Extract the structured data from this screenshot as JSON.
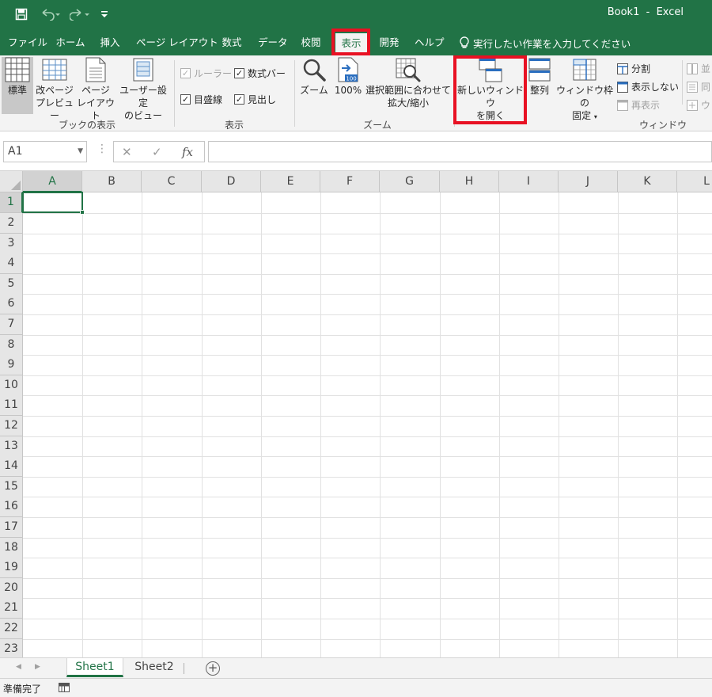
{
  "window": {
    "title": "Book1  -  Excel"
  },
  "quick_access": {
    "save": "save-icon",
    "undo": "undo-icon",
    "redo": "redo-icon",
    "customize": "customize-icon"
  },
  "tabs": [
    {
      "label": "ファイル",
      "active": false
    },
    {
      "label": "ホーム",
      "active": false
    },
    {
      "label": "挿入",
      "active": false
    },
    {
      "label": "ページ レイアウト",
      "active": false
    },
    {
      "label": "数式",
      "active": false
    },
    {
      "label": "データ",
      "active": false
    },
    {
      "label": "校閲",
      "active": false
    },
    {
      "label": "表示",
      "active": true
    },
    {
      "label": "開発",
      "active": false
    },
    {
      "label": "ヘルプ",
      "active": false
    }
  ],
  "tell_me": "実行したい作業を入力してください",
  "ribbon": {
    "workbook_views": {
      "label": "ブックの表示",
      "normal": "標準",
      "page_break_1": "改ページ",
      "page_break_2": "プレビュー",
      "page_layout_1": "ページ",
      "page_layout_2": "レイアウト",
      "custom_views_1": "ユーザー設定",
      "custom_views_2": "のビュー"
    },
    "show": {
      "label": "表示",
      "ruler": "ルーラー",
      "formula_bar": "数式バー",
      "gridlines": "目盛線",
      "headings": "見出し"
    },
    "zoom": {
      "label": "ズーム",
      "zoom": "ズーム",
      "hundred": "100%",
      "zoom_selection_1": "選択範囲に合わせて",
      "zoom_selection_2": "拡大/縮小"
    },
    "window": {
      "label": "ウィンドウ",
      "new_window_1": "新しいウィンドウ",
      "new_window_2": "を開く",
      "arrange": "整列",
      "freeze_1": "ウィンドウ枠の",
      "freeze_2": "固定",
      "split": "分割",
      "hide": "表示しない",
      "unhide": "再表示",
      "side_by_side": "並",
      "sync_scroll": "同",
      "reset_position": "ウ"
    }
  },
  "formula_bar": {
    "name_box": "A1",
    "fx": "fx",
    "value": ""
  },
  "columns": [
    "A",
    "B",
    "C",
    "D",
    "E",
    "F",
    "G",
    "H",
    "I",
    "J",
    "K",
    "L"
  ],
  "rows": [
    "1",
    "2",
    "3",
    "4",
    "5",
    "6",
    "7",
    "8",
    "9",
    "10",
    "11",
    "12",
    "13",
    "14",
    "15",
    "16",
    "17",
    "18",
    "19",
    "20",
    "21",
    "22",
    "23"
  ],
  "sheets": [
    {
      "label": "Sheet1",
      "active": true
    },
    {
      "label": "Sheet2",
      "active": false
    }
  ],
  "status": {
    "text": "準備完了"
  },
  "colors": {
    "accent": "#217346",
    "highlight": "#e81123"
  }
}
